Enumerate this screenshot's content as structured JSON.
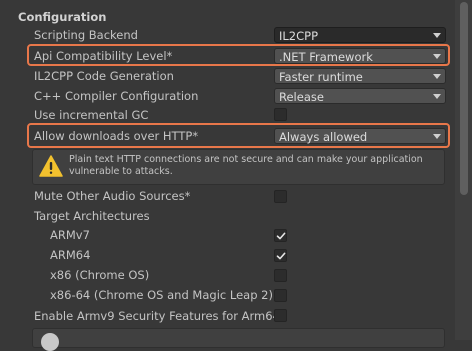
{
  "section": {
    "title": "Configuration"
  },
  "rows": {
    "scripting_backend": {
      "label": "Scripting Backend",
      "value": "IL2CPP"
    },
    "api_compat": {
      "label": "Api Compatibility Level*",
      "value": ".NET Framework"
    },
    "il2cpp_codegen": {
      "label": "IL2CPP Code Generation",
      "value": "Faster runtime"
    },
    "cpp_compiler": {
      "label": "C++ Compiler Configuration",
      "value": "Release"
    },
    "incremental_gc": {
      "label": "Use incremental GC",
      "checked": false
    },
    "allow_downloads": {
      "label": "Allow downloads over HTTP*",
      "value": "Always allowed"
    },
    "mute_audio": {
      "label": "Mute Other Audio Sources*",
      "checked": false
    },
    "target_arch": {
      "label": "Target Architectures"
    },
    "armv7": {
      "label": "ARMv7",
      "checked": true
    },
    "arm64": {
      "label": "ARM64",
      "checked": true
    },
    "x86": {
      "label": "x86 (Chrome OS)",
      "checked": false
    },
    "x86_64": {
      "label": "x86-64 (Chrome OS and Magic Leap 2)",
      "checked": false
    },
    "armv9": {
      "label": "Enable Armv9 Security Features for Arm64",
      "checked": false
    }
  },
  "warning": {
    "icon": "warning-icon",
    "text": "Plain text HTTP connections are not secure and can make your application vulnerable to attacks."
  },
  "colors": {
    "highlight": "#e8774a",
    "background": "#383838"
  }
}
